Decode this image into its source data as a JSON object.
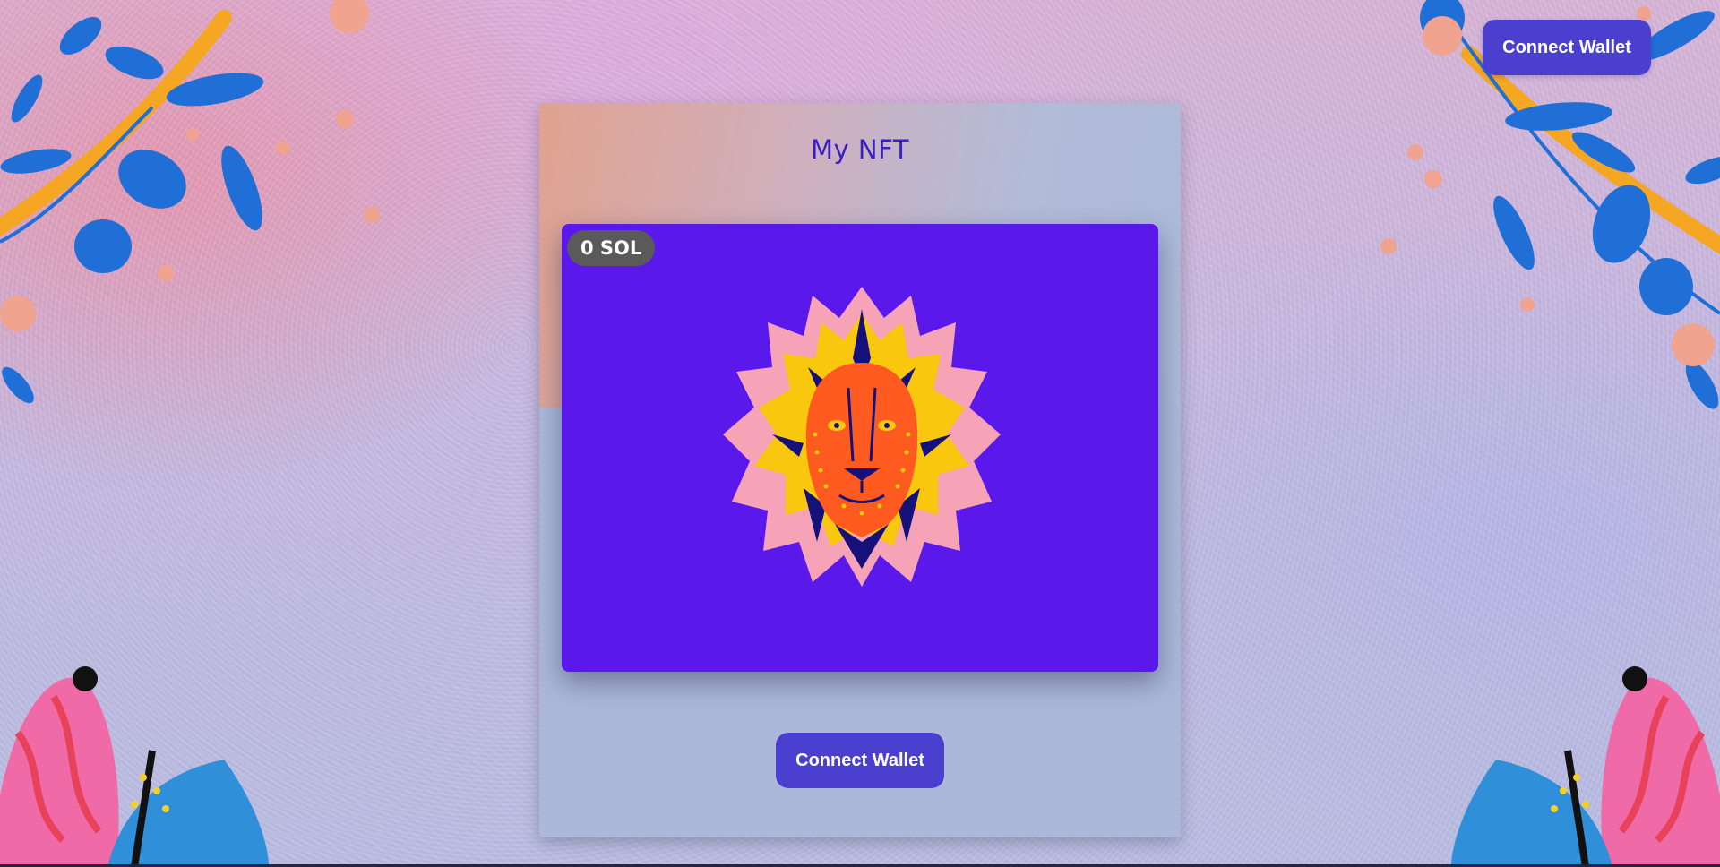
{
  "header": {
    "connect_wallet_label": "Connect Wallet"
  },
  "card": {
    "title": "My NFT",
    "price_badge": "0 SOL",
    "connect_wallet_label": "Connect Wallet"
  },
  "colors": {
    "button_bg": "#4b3fcf",
    "nft_background": "#5a18ea",
    "title_color": "#3b1fc2",
    "badge_bg": "#5a5a5a"
  },
  "icons": {
    "nft_image": "lion-head-illustration",
    "decor": [
      "blue-leaf-branch",
      "pink-flower"
    ]
  }
}
